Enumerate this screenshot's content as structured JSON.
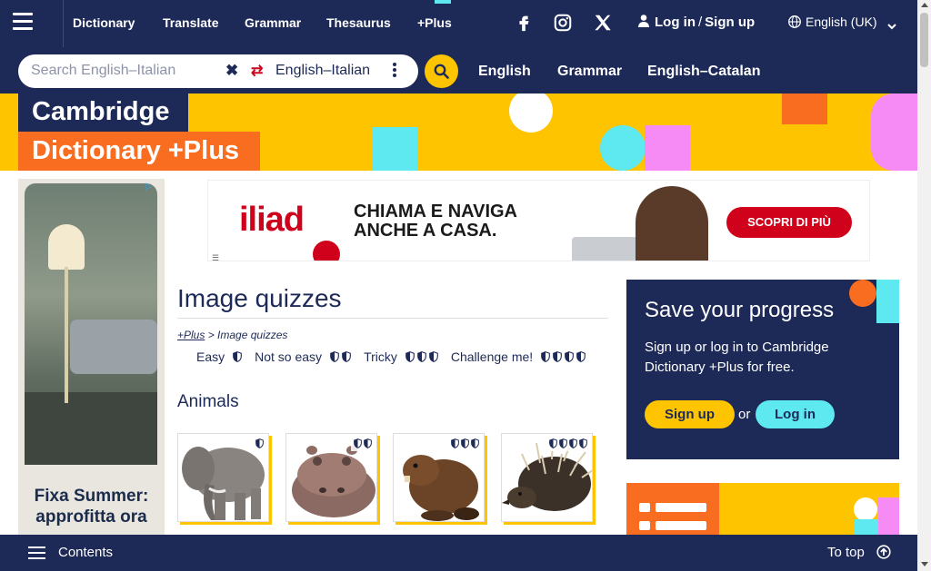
{
  "nav": {
    "links": [
      "Dictionary",
      "Translate",
      "Grammar",
      "Thesaurus",
      "+Plus"
    ],
    "login": "Log in",
    "separator": "/",
    "signup": "Sign up",
    "language": "English (UK)"
  },
  "search": {
    "placeholder": "Search English–Italian",
    "dictionary": "English–Italian",
    "quick_links": [
      "English",
      "Grammar",
      "English–Catalan"
    ]
  },
  "logo": {
    "line1": "Cambridge",
    "line2": "Dictionary +Plus"
  },
  "ads": {
    "side_text": "Fixa Summer: approfitta ora",
    "top_brand": "iliad",
    "top_headline_1": "CHIAMA E NAVIGA",
    "top_headline_2": "ANCHE A CASA.",
    "top_cta": "SCOPRI DI PIÙ"
  },
  "main": {
    "title": "Image quizzes",
    "breadcrumb_link": "+Plus",
    "breadcrumb_rest": "> Image quizzes",
    "levels": [
      {
        "label": "Easy",
        "shields": 1
      },
      {
        "label": "Not so easy",
        "shields": 2
      },
      {
        "label": "Tricky",
        "shields": 3
      },
      {
        "label": "Challenge me!",
        "shields": 4
      }
    ],
    "section": "Animals",
    "quizzes": [
      {
        "animal": "elephant",
        "level": 1
      },
      {
        "animal": "hippopotamus",
        "level": 2
      },
      {
        "animal": "beaver",
        "level": 3
      },
      {
        "animal": "echidna",
        "level": 4
      }
    ]
  },
  "panel": {
    "title": "Save your progress",
    "text": "Sign up or log in to Cambridge Dictionary +Plus for free.",
    "signup": "Sign up",
    "or": "or",
    "login": "Log in"
  },
  "bottom": {
    "contents": "Contents",
    "to_top": "To top"
  },
  "colors": {
    "navy": "#1d2a57",
    "yellow": "#fec400",
    "orange": "#f96d20",
    "cyan": "#5ee8f0",
    "pink": "#f78bf6",
    "red": "#d0021b"
  }
}
